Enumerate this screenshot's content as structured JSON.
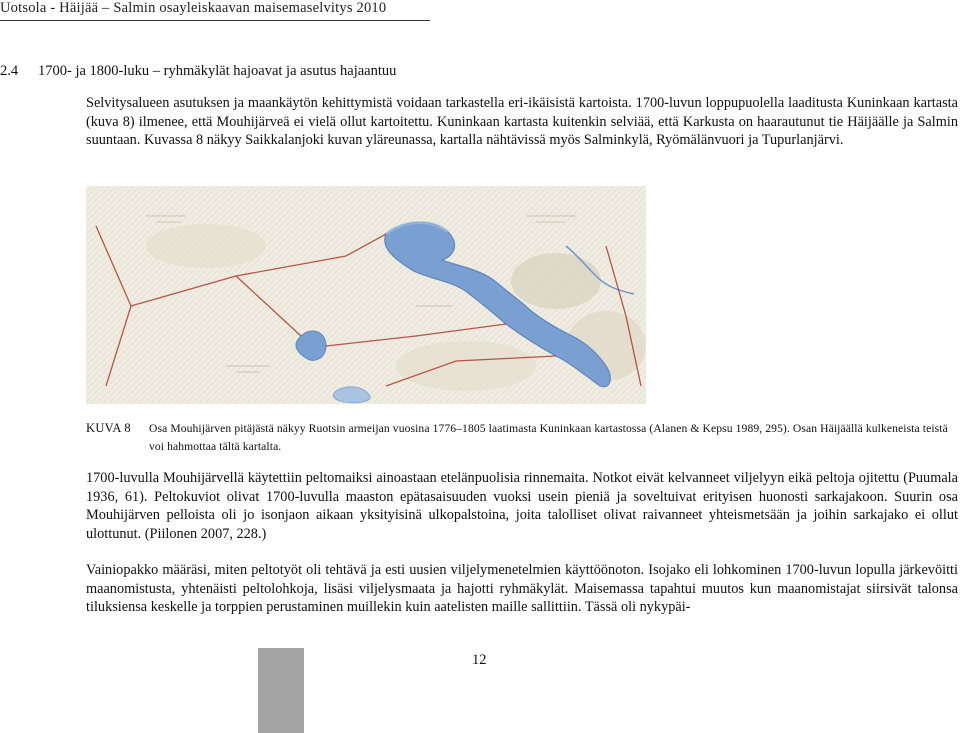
{
  "header": {
    "text": "Uotsola - Häijää – Salmin osayleiskaavan maisemaselvitys 2010"
  },
  "section": {
    "number": "2.4",
    "title": "1700- ja 1800-luku – ryhmäkylät hajoavat ja asutus hajaantuu"
  },
  "paragraphs": {
    "p1": "Selvitysalueen asutuksen ja maankäytön kehittymistä voidaan tarkastella eri-ikäisistä kartoista. 1700-luvun loppupuolella laaditusta Kuninkaan kartasta (kuva 8) ilmenee, että Mouhijärveä ei vielä ollut kartoitettu. Kuninkaan kartasta kuitenkin selviää, että Karkusta on haarautunut tie Häijäälle ja Salmin suuntaan. Kuvassa 8 näkyy Saikkalanjoki kuvan yläreunassa, kartalla nähtävissä myös Salminkylä, Ryömälänvuori ja Tupurlanjärvi.",
    "p2": "1700-luvulla Mouhijärvellä käytettiin peltomaiksi ainoastaan etelänpuolisia rinnemaita. Notkot eivät kelvanneet viljelyyn eikä peltoja ojitettu (Puumala 1936, 61). Peltokuviot olivat 1700-luvulla maaston epätasaisuuden vuoksi usein pieniä ja soveltuivat erityisen huonosti sarkajakoon. Suurin osa Mouhijärven pelloista oli jo isonjaon aikaan yksityisinä ulkopalstoina, joita talolliset olivat raivanneet yhteismetsään ja joihin sarkajako ei ollut ulottunut. (Piilonen 2007, 228.)",
    "p3": "Vainiopakko määräsi, miten peltotyöt oli tehtävä ja esti uusien viljelymenetelmien käyttöönoton. Isojako eli lohkominen 1700-luvun lopulla järkevöitti maanomistusta, yhtenäisti peltolohkoja, lisäsi viljelysmaata ja hajotti ryhmäkylät. Maisemassa tapahtui muutos kun maanomistajat siirsivät talonsa tiluksiensa keskelle ja torppien perustaminen muillekin kuin aatelisten maille sallittiin. Tässä oli nykypäi-"
  },
  "figure": {
    "label": "KUVA 8",
    "caption": "Osa Mouhijärven pitäjästä näkyy Ruotsin armeijan vuosina 1776–1805 laatimasta Kuninkaan kartastossa (Alanen & Kepsu 1989, 295). Osan Häijäällä kulkeneista teistä voi hahmottaa tältä kartalta.",
    "colors": {
      "paper": "#efece1",
      "water": "#6e96cc",
      "water_light": "#a9c4e3",
      "road": "#b23a2a",
      "ink": "#7c6f5f"
    }
  },
  "footer": {
    "page_number": "12"
  }
}
